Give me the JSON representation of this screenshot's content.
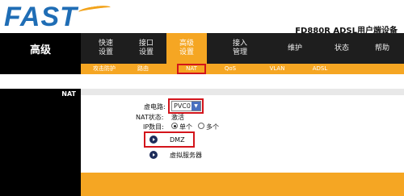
{
  "header": {
    "logo": "FAST",
    "model": "FD880R ADSL用户端设备"
  },
  "section": {
    "title": "高级"
  },
  "main_tabs": [
    {
      "line1": "快速",
      "line2": "设置"
    },
    {
      "line1": "接口",
      "line2": "设置"
    },
    {
      "line1": "高级",
      "line2": "设置"
    },
    {
      "line1": "接入",
      "line2": "管理"
    },
    {
      "line1": "维护",
      "line2": ""
    },
    {
      "line1": "状态",
      "line2": ""
    },
    {
      "line1": "帮助",
      "line2": ""
    }
  ],
  "sub_tabs": [
    "攻击防护",
    "路由",
    "NAT",
    "QoS",
    "VLAN",
    "ADSL"
  ],
  "content": {
    "left_label": "NAT",
    "pvc_label": "虚电路:",
    "pvc_value": "PVC0",
    "nat_status_label": "NAT状态:",
    "nat_status_value": "激活",
    "ip_count_label": "IP数目:",
    "ip_option_single": "单个",
    "ip_option_multi": "多个",
    "link_dmz": "DMZ",
    "link_virtual_server": "虚拟服务器"
  },
  "colors": {
    "accent": "#f5a623",
    "highlight": "#d3141b",
    "dark": "#000000",
    "logo": "#1f6db5"
  }
}
